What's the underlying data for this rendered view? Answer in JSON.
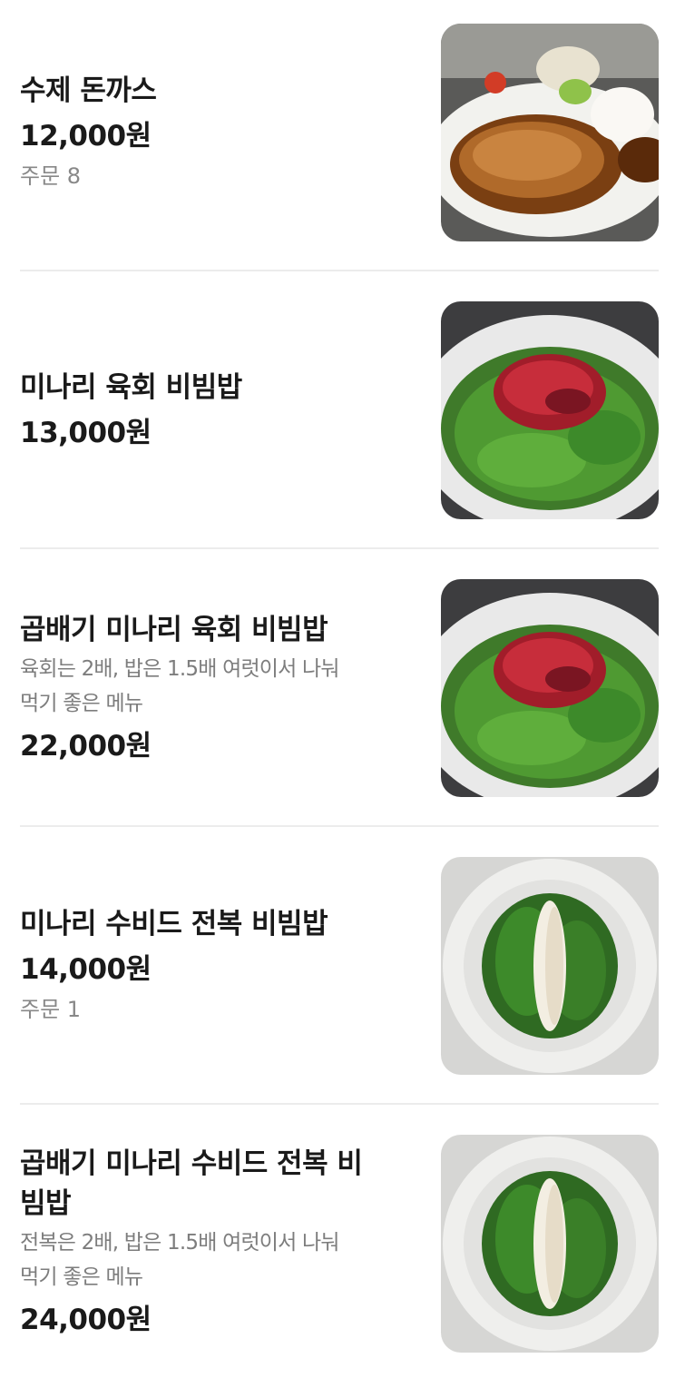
{
  "menu": {
    "items": [
      {
        "name": "수제 돈까스",
        "price": "12,000원",
        "orders": "주문 8",
        "image": "tonkatsu-photo"
      },
      {
        "name": "미나리 육회 비빔밥",
        "price": "13,000원",
        "image": "yukhoe-bibimbap-photo"
      },
      {
        "name": "곱배기 미나리 육회 비빔밥",
        "desc_1": "육회는 2배, 밥은 1.5배 여럿이서 나눠",
        "desc_2": "먹기 좋은 메뉴",
        "price": "22,000원",
        "image": "yukhoe-bibimbap-photo"
      },
      {
        "name": "미나리 수비드 전복 비빔밥",
        "price": "14,000원",
        "orders": "주문 1",
        "image": "abalone-bibimbap-photo"
      },
      {
        "name_1": "곱배기 미나리 수비드 전복 비",
        "name_2": "빔밥",
        "desc_1": "전복은 2배, 밥은 1.5배 여럿이서 나눠",
        "desc_2": "먹기 좋은 메뉴",
        "price": "24,000원",
        "image": "abalone-bibimbap-photo"
      }
    ]
  }
}
